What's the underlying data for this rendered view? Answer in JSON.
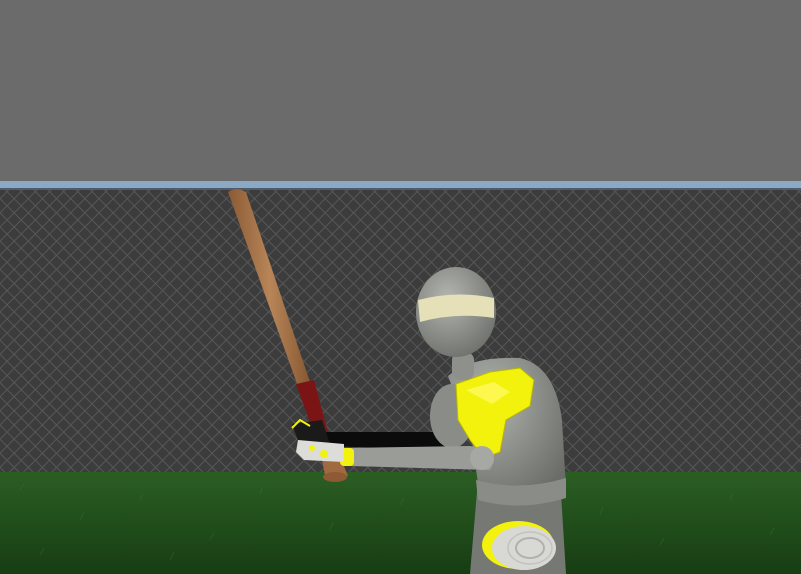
{
  "scene": {
    "description_tag": "3d-render-batter",
    "colors": {
      "sky": "#6a6a6a",
      "fence_rail": "#8aa7c4",
      "fence_mesh": "#3a3a3a",
      "fence_wire": "#5a5a5a",
      "grass": "#1f4a1a",
      "grass_light": "#2f6b24",
      "bat_wood": "#a8744a",
      "bat_grip": "#7a1414",
      "mannequin": "#9a9c98",
      "mannequin_dark": "#6f716d",
      "armor": "#f2f20c",
      "headband": "#e8e2b8",
      "arm_black": "#0a0a0a"
    }
  }
}
